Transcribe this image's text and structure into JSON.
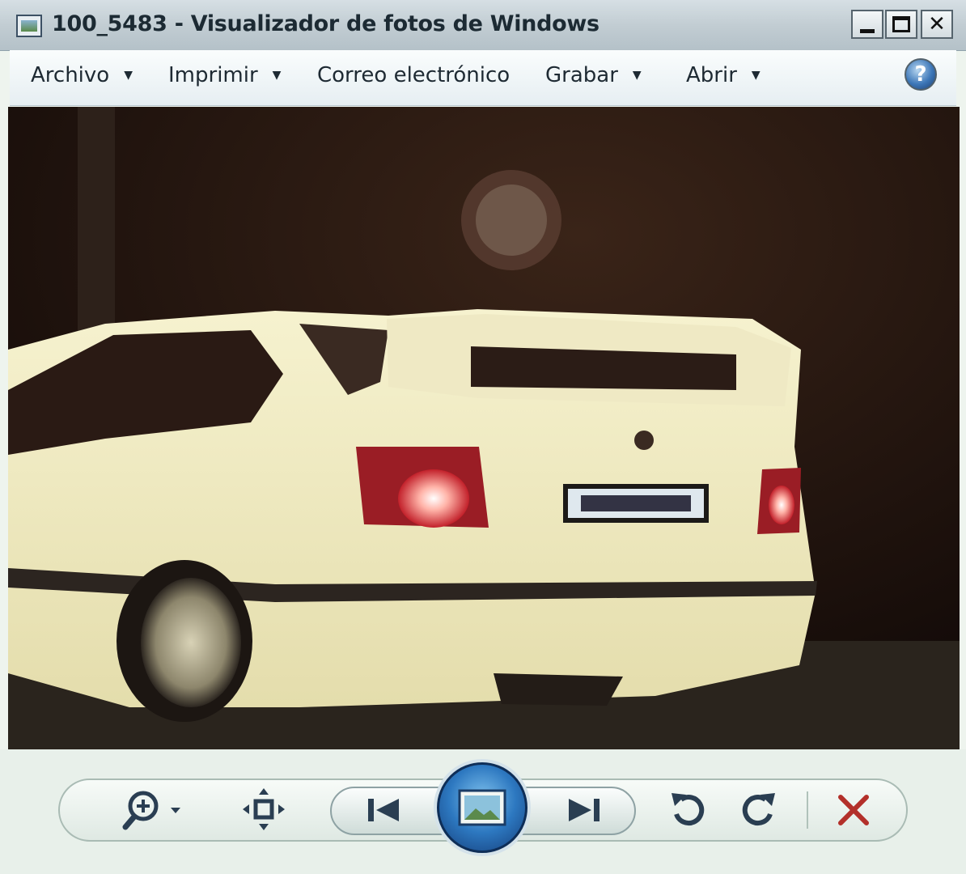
{
  "window": {
    "title": "100_5483 - Visualizador de fotos de Windows",
    "controls": {
      "minimize": "_",
      "maximize": "□",
      "close": "✕"
    }
  },
  "menu": {
    "items": [
      {
        "label": "Archivo",
        "has_dropdown": true
      },
      {
        "label": "Imprimir",
        "has_dropdown": true
      },
      {
        "label": "Correo electrónico",
        "has_dropdown": false
      },
      {
        "label": "Grabar",
        "has_dropdown": true
      },
      {
        "label": "Abrir",
        "has_dropdown": true
      }
    ],
    "help": "?"
  },
  "toolbar": {
    "buttons": [
      {
        "icon": "zoom-icon"
      },
      {
        "icon": "actual-size-icon"
      },
      {
        "icon": "previous-icon"
      },
      {
        "icon": "slideshow-icon"
      },
      {
        "icon": "next-icon"
      },
      {
        "icon": "rotate-counterclockwise-icon"
      },
      {
        "icon": "rotate-clockwise-icon"
      },
      {
        "icon": "delete-icon"
      }
    ]
  },
  "colors": {
    "delete": "#b3302a",
    "icon": "#2a3e52",
    "car_body": "#f1ecc2",
    "night_background": "#1a0f0c"
  }
}
